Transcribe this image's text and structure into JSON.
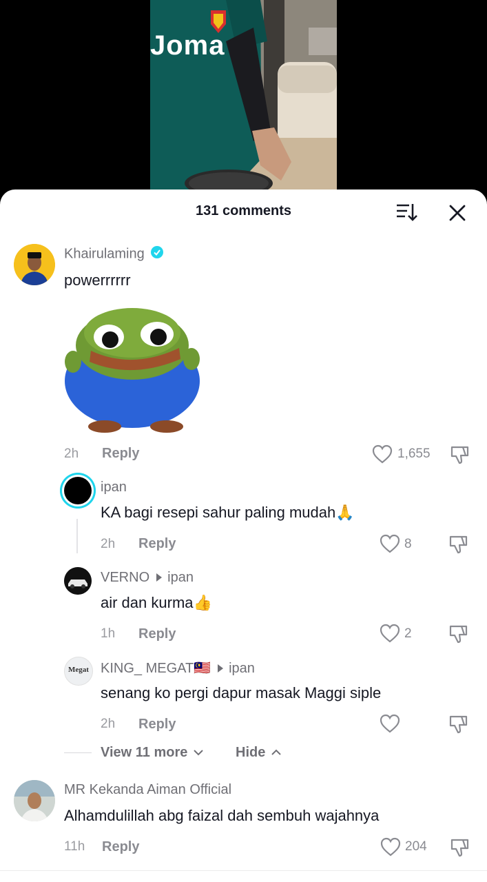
{
  "video": {
    "jersey_text": "Joma"
  },
  "panel": {
    "title": "131 comments",
    "sort_icon": "sort-icon",
    "close_icon": "close-icon"
  },
  "comments": [
    {
      "username": "Khairulaming",
      "verified": true,
      "text": "powerrrrrr",
      "sticker": "pepe-frog-hug-sticker",
      "time": "2h",
      "reply_label": "Reply",
      "likes": "1,655"
    },
    {
      "username": "ipan",
      "text": "KA bagi resepi sahur paling mudah🙏",
      "time": "2h",
      "reply_label": "Reply",
      "likes": "8"
    },
    {
      "username": "VERNO",
      "reply_to": "ipan",
      "text": "air dan kurma👍",
      "time": "1h",
      "reply_label": "Reply",
      "likes": "2"
    },
    {
      "username": "KING_ MEGAT🇲🇾",
      "reply_to": "ipan",
      "avatar_text": "Megat",
      "text": "senang ko pergi dapur masak Maggi siple",
      "time": "2h",
      "reply_label": "Reply",
      "likes": ""
    },
    {
      "username": "MR Kekanda Aiman Official",
      "text": "Alhamdulillah abg faizal dah sembuh wajahnya",
      "time": "11h",
      "reply_label": "Reply",
      "likes": "204"
    }
  ],
  "thread": {
    "view_more": "View 11 more",
    "hide": "Hide"
  },
  "colors": {
    "accent": "#20d5ec",
    "verified": "#20d5ec",
    "text": "#161823",
    "muted": "#8a8b91"
  }
}
